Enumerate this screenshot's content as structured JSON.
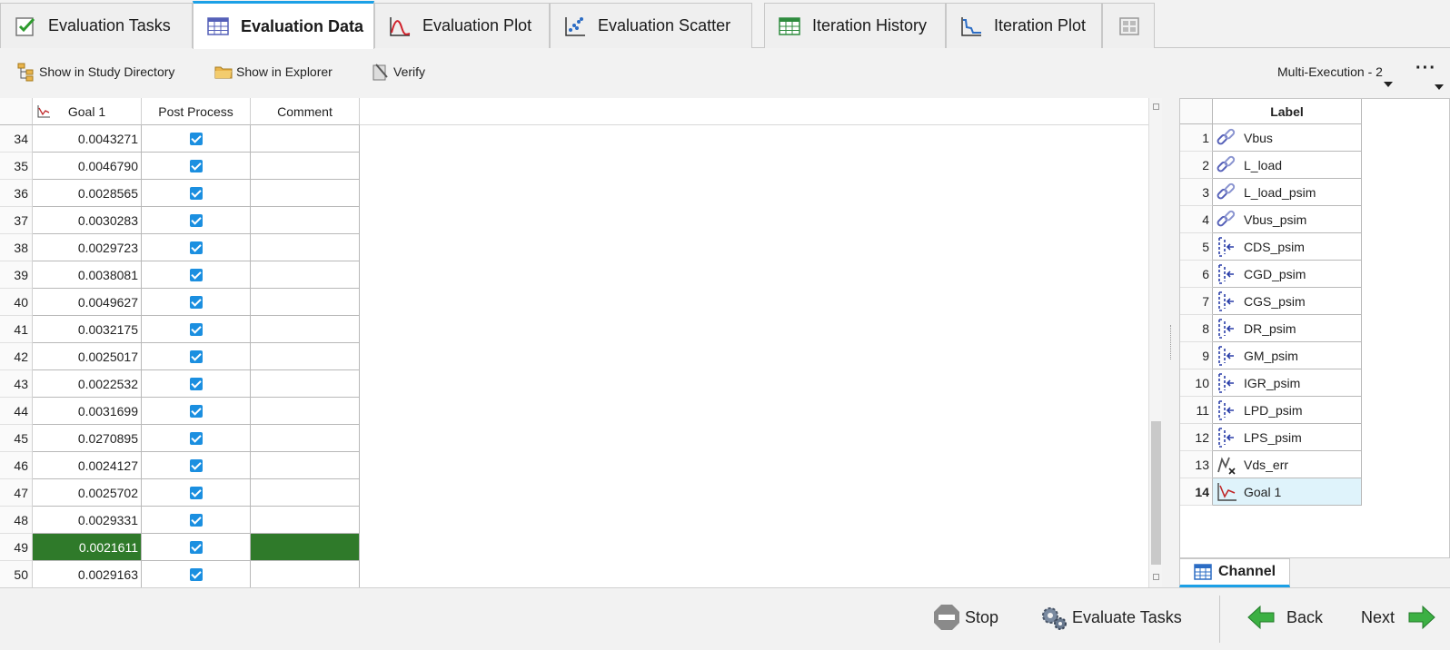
{
  "tabs": [
    {
      "label": "Evaluation Tasks",
      "icon": "checklist-icon"
    },
    {
      "label": "Evaluation Data",
      "icon": "table-icon"
    },
    {
      "label": "Evaluation Plot",
      "icon": "line-plot-icon"
    },
    {
      "label": "Evaluation Scatter",
      "icon": "scatter-icon"
    },
    {
      "label": "Iteration History",
      "icon": "history-table-icon"
    },
    {
      "label": "Iteration Plot",
      "icon": "iteration-plot-icon"
    }
  ],
  "active_tab": "Evaluation Data",
  "toolbar": {
    "show_study_dir": "Show in Study Directory",
    "show_explorer": "Show in Explorer",
    "verify": "Verify",
    "execution": "Multi-Execution - 2",
    "more": "···"
  },
  "table": {
    "columns": [
      "Goal 1",
      "Post Process",
      "Comment"
    ],
    "rows": [
      {
        "n": "34",
        "goal": "0.0043271",
        "post": true,
        "comment": ""
      },
      {
        "n": "35",
        "goal": "0.0046790",
        "post": true,
        "comment": ""
      },
      {
        "n": "36",
        "goal": "0.0028565",
        "post": true,
        "comment": ""
      },
      {
        "n": "37",
        "goal": "0.0030283",
        "post": true,
        "comment": ""
      },
      {
        "n": "38",
        "goal": "0.0029723",
        "post": true,
        "comment": ""
      },
      {
        "n": "39",
        "goal": "0.0038081",
        "post": true,
        "comment": ""
      },
      {
        "n": "40",
        "goal": "0.0049627",
        "post": true,
        "comment": ""
      },
      {
        "n": "41",
        "goal": "0.0032175",
        "post": true,
        "comment": ""
      },
      {
        "n": "42",
        "goal": "0.0025017",
        "post": true,
        "comment": ""
      },
      {
        "n": "43",
        "goal": "0.0022532",
        "post": true,
        "comment": ""
      },
      {
        "n": "44",
        "goal": "0.0031699",
        "post": true,
        "comment": ""
      },
      {
        "n": "45",
        "goal": "0.0270895",
        "post": true,
        "comment": ""
      },
      {
        "n": "46",
        "goal": "0.0024127",
        "post": true,
        "comment": ""
      },
      {
        "n": "47",
        "goal": "0.0025702",
        "post": true,
        "comment": ""
      },
      {
        "n": "48",
        "goal": "0.0029331",
        "post": true,
        "comment": ""
      },
      {
        "n": "49",
        "goal": "0.0021611",
        "post": true,
        "comment": "",
        "selected": true
      },
      {
        "n": "50",
        "goal": "0.0029163",
        "post": true,
        "comment": ""
      }
    ]
  },
  "channel": {
    "header": "Label",
    "tab_label": "Channel",
    "items": [
      {
        "n": "1",
        "label": "Vbus",
        "icon": "link-icon"
      },
      {
        "n": "2",
        "label": "L_load",
        "icon": "link-icon"
      },
      {
        "n": "3",
        "label": "L_load_psim",
        "icon": "link-icon"
      },
      {
        "n": "4",
        "label": "Vbus_psim",
        "icon": "link-icon"
      },
      {
        "n": "5",
        "label": "CDS_psim",
        "icon": "input-variable-icon"
      },
      {
        "n": "6",
        "label": "CGD_psim",
        "icon": "input-variable-icon"
      },
      {
        "n": "7",
        "label": "CGS_psim",
        "icon": "input-variable-icon"
      },
      {
        "n": "8",
        "label": "DR_psim",
        "icon": "input-variable-icon"
      },
      {
        "n": "9",
        "label": "GM_psim",
        "icon": "input-variable-icon"
      },
      {
        "n": "10",
        "label": "IGR_psim",
        "icon": "input-variable-icon"
      },
      {
        "n": "11",
        "label": "LPD_psim",
        "icon": "input-variable-icon"
      },
      {
        "n": "12",
        "label": "LPS_psim",
        "icon": "input-variable-icon"
      },
      {
        "n": "13",
        "label": "Vds_err",
        "icon": "output-response-icon"
      },
      {
        "n": "14",
        "label": "Goal 1",
        "icon": "goal-icon",
        "highlighted": true
      }
    ]
  },
  "bottom": {
    "stop": "Stop",
    "evaluate": "Evaluate Tasks",
    "back": "Back",
    "next": "Next"
  },
  "colors": {
    "accent": "#1ca0e6",
    "selected_row": "#2f7a2a",
    "checkbox": "#1b8fe0",
    "highlight_row": "#dff3fb",
    "nav_arrow": "#3cb043"
  }
}
